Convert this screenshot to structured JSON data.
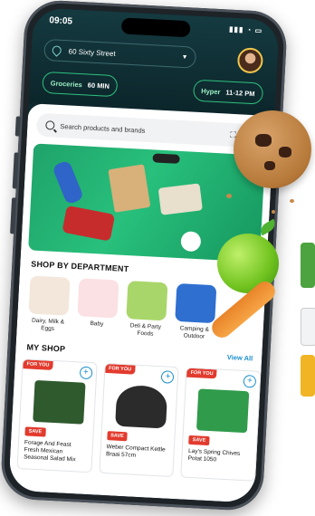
{
  "status": {
    "time": "09:05",
    "signal_icons": "▮▮▮ ◔ ▭"
  },
  "header": {
    "location": "60 Sixty Street",
    "chips": [
      {
        "label": "Groceries",
        "time": "60 MIN"
      },
      {
        "label": "Hyper",
        "time": "11-12 PM"
      }
    ]
  },
  "search": {
    "placeholder": "Search products and brands"
  },
  "departments": {
    "title": "SHOP BY DEPARTMENT",
    "items": [
      {
        "label": "Dairy, Milk & Eggs",
        "color": "#f3e7dc"
      },
      {
        "label": "Baby",
        "color": "#fbe1e3"
      },
      {
        "label": "Deli & Party Foods",
        "color": "#a9d66a"
      },
      {
        "label": "Camping & Outdoor",
        "color": "#2f6fd0"
      }
    ]
  },
  "myshop": {
    "title": "MY SHOP",
    "view_all": "View All",
    "products": [
      {
        "badge": "FOR YOU",
        "save": "SAVE",
        "name": "Forage And Feast Fresh Mexican Seasonal Salad Mix",
        "color": "#2f5a2e"
      },
      {
        "badge": "FOR YOU",
        "save": "SAVE",
        "name": "Weber Compact Kettle Braai 57cm",
        "color": "#2b2b2b"
      },
      {
        "badge": "FOR YOU",
        "save": "SAVE",
        "name": "Lay's Spring Chives Potat 1050",
        "color": "#2f9b4b"
      }
    ]
  }
}
